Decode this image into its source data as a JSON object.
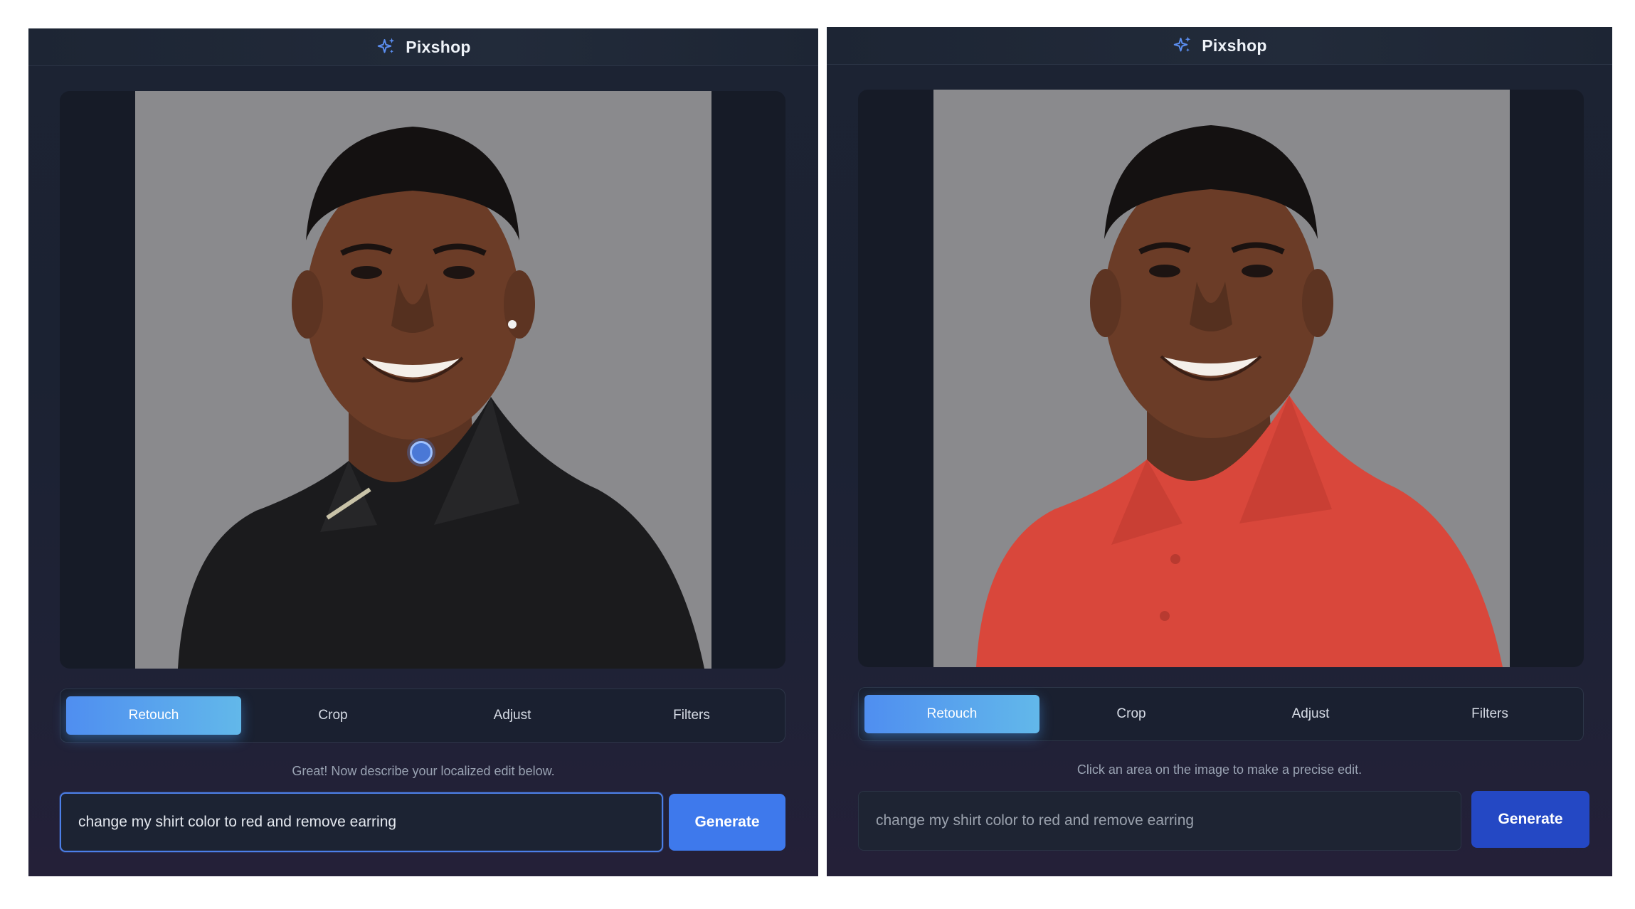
{
  "panels": [
    {
      "id": "before",
      "brand": "Pixshop",
      "tabs": [
        "Retouch",
        "Crop",
        "Adjust",
        "Filters"
      ],
      "active_tab": "Retouch",
      "hint": "Great! Now describe your localized edit below.",
      "prompt_value": "change my shirt color to red and remove earring",
      "generate_label": "Generate",
      "shirt_color": "#1b1b1d"
    },
    {
      "id": "after",
      "brand": "Pixshop",
      "tabs": [
        "Retouch",
        "Crop",
        "Adjust",
        "Filters"
      ],
      "active_tab": "Retouch",
      "hint": "Click an area on the image to make a precise edit.",
      "prompt_value": "change my shirt color to red and remove earring",
      "generate_label": "Generate",
      "shirt_color": "#d9473b"
    }
  ],
  "icons": {
    "brand": "sparkles-icon"
  },
  "colors": {
    "accent": "#4f8ef0",
    "generate": "#3e79ec",
    "background": "#1c2333"
  }
}
